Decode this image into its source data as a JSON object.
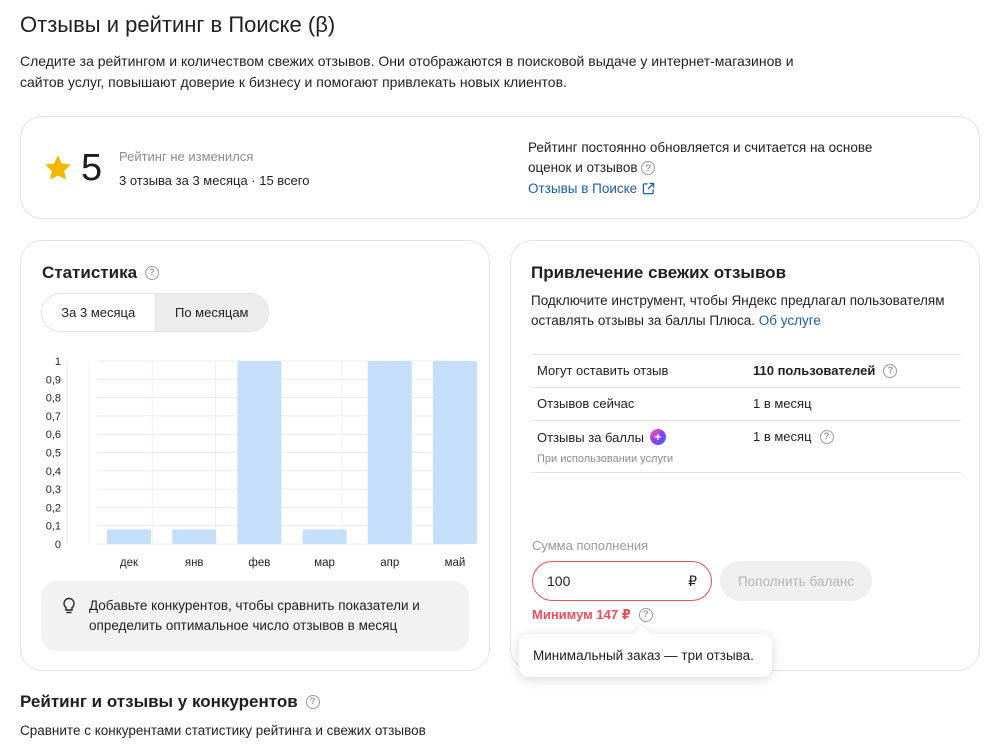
{
  "page": {
    "title": "Отзывы и рейтинг в Поиске (β)",
    "description": "Следите за рейтингом и количеством свежих отзывов. Они отображаются в поисковой выдаче у интернет-магазинов и сайтов услуг, повышают доверие к бизнесу и помогают привлекать новых клиентов."
  },
  "rating": {
    "score": "5",
    "status": "Рейтинг не изменился",
    "count": "3 отзыва за 3 месяца · 15 всего",
    "note": "Рейтинг постоянно обновляется и считается на основе оценок и отзывов",
    "link": "Отзывы в Поиске",
    "star_color": "#f5b800"
  },
  "statistics": {
    "title": "Статистика",
    "tabs": [
      "За 3 месяца",
      "По месяцам"
    ],
    "active_tab": "По месяцам",
    "hint": "Добавьте конкурентов, чтобы сравнить показатели и определить оптимальное число отзывов в месяц"
  },
  "chart_data": {
    "type": "bar",
    "categories": [
      "дек",
      "янв",
      "фев",
      "мар",
      "апр",
      "май"
    ],
    "values": [
      0.08,
      0.08,
      1,
      0.08,
      1,
      1
    ],
    "ylim": [
      0,
      1
    ],
    "yticks": [
      "0",
      "0,1",
      "0,2",
      "0,3",
      "0,4",
      "0,5",
      "0,6",
      "0,7",
      "0,8",
      "0,9",
      "1"
    ],
    "bar_color": "#c5dffb",
    "grid": true
  },
  "attract": {
    "title": "Привлечение свежих отзывов",
    "desc": "Подключите инструмент, чтобы Яндекс предлагал пользователям оставлять отзывы за баллы Плюса.",
    "desc_link": "Об услуге",
    "rows": [
      {
        "label": "Могут оставить отзыв",
        "value": "110 пользователей"
      },
      {
        "label": "Отзывов сейчас",
        "value": "1 в месяц"
      },
      {
        "label": "Отзывы за баллы",
        "sub": "При использовании услуги",
        "value": "1 в месяц"
      }
    ],
    "amount_label": "Сумма пополнения",
    "amount_value": "100",
    "currency": "₽",
    "topup_button": "Пополнить баланс",
    "min_error": "Минимум 147 ₽",
    "tooltip": "Минимальный заказ — три отзыва."
  },
  "competitors": {
    "title": "Рейтинг и отзывы у конкурентов",
    "desc": "Сравните с конкурентами статистику рейтинга и свежих отзывов"
  }
}
